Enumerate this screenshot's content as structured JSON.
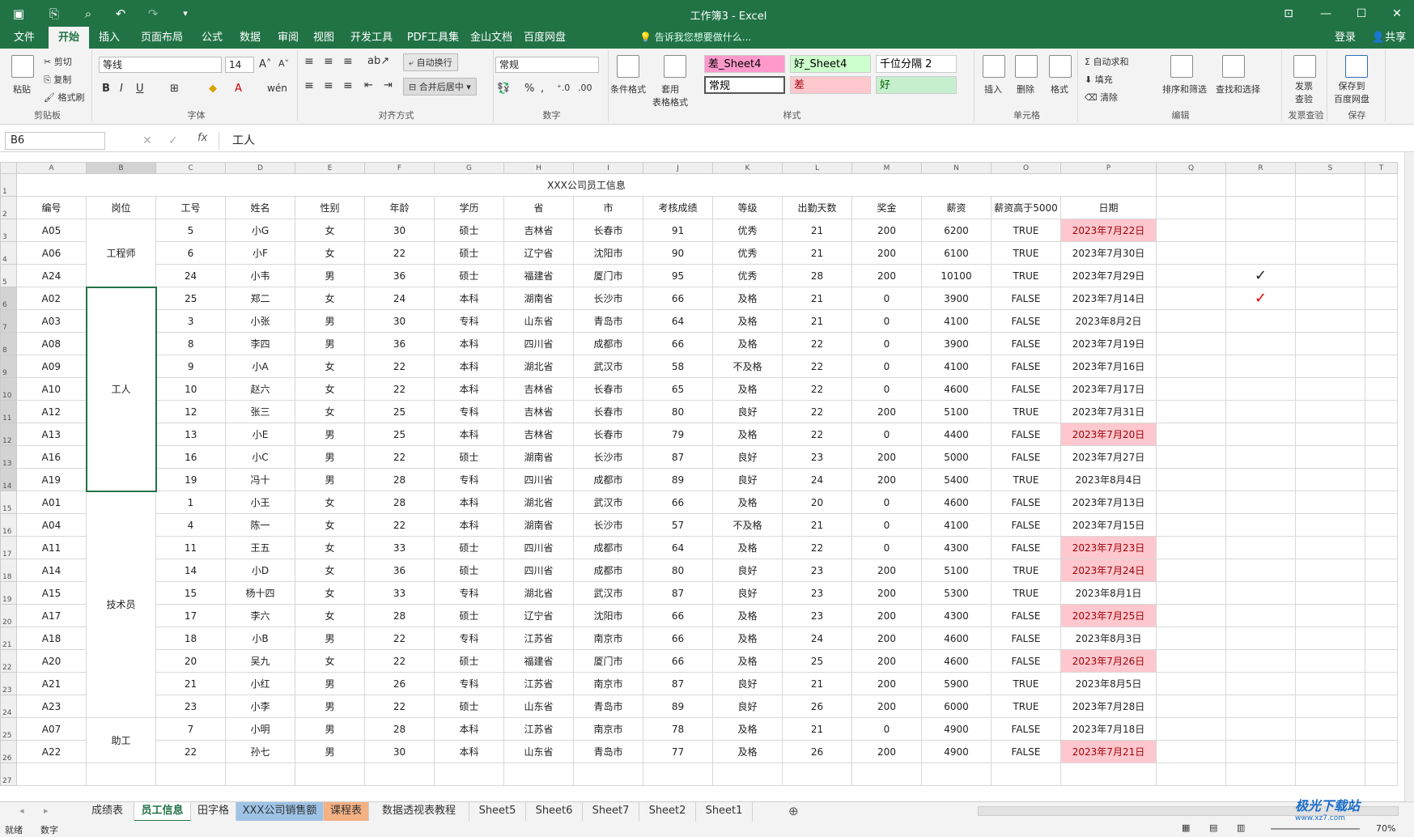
{
  "title": "工作簿3 - Excel",
  "menu": [
    "文件",
    "开始",
    "插入",
    "页面布局",
    "公式",
    "数据",
    "审阅",
    "视图",
    "开发工具",
    "PDF工具集",
    "金山文档",
    "百度网盘"
  ],
  "tell": "告诉我您想要做什么...",
  "account": {
    "login": "登录",
    "share": "共享"
  },
  "ribbon": {
    "clipboard": {
      "label": "剪贴板",
      "paste": "粘贴",
      "cut": "剪切",
      "copy": "复制",
      "painter": "格式刷"
    },
    "font": {
      "label": "字体",
      "name": "等线",
      "size": "14"
    },
    "align": {
      "label": "对齐方式",
      "wrap": "自动换行",
      "merge": "合并后居中"
    },
    "number": {
      "label": "数字",
      "format": "常规"
    },
    "styles": {
      "label": "样式",
      "cond": "条件格式",
      "table": "套用\n表格格式",
      "boxes": [
        "差_Sheet4",
        "好_Sheet4",
        "千位分隔 2",
        "常规",
        "差",
        "好"
      ]
    },
    "cells": {
      "label": "单元格",
      "insert": "插入",
      "delete": "删除",
      "format": "格式"
    },
    "edit": {
      "label": "编辑",
      "autosum": "自动求和",
      "fill": "填充",
      "clear": "清除",
      "sort": "排序和筛选",
      "find": "查找和选择"
    },
    "invoice": {
      "label": "发票查验",
      "btn": "发票\n查验"
    },
    "save": {
      "label": "保存",
      "btn": "保存到\n百度网盘"
    }
  },
  "namebox": "B6",
  "formula": "工人",
  "columns": [
    "A",
    "B",
    "C",
    "D",
    "E",
    "F",
    "G",
    "H",
    "I",
    "J",
    "K",
    "L",
    "M",
    "N",
    "O",
    "P",
    "Q",
    "R",
    "S",
    "T"
  ],
  "sheet_title": "XXX公司员工信息",
  "headers": [
    "编号",
    "岗位",
    "工号",
    "姓名",
    "性别",
    "年龄",
    "学历",
    "省",
    "市",
    "考核成绩",
    "等级",
    "出勤天数",
    "奖金",
    "薪资",
    "薪资高于5000",
    "日期"
  ],
  "groups": [
    {
      "label": "工程师",
      "start": 3,
      "span": 3
    },
    {
      "label": "工人",
      "start": 6,
      "span": 9
    },
    {
      "label": "技术员",
      "start": 15,
      "span": 10
    },
    {
      "label": "助工",
      "start": 25,
      "span": 2
    }
  ],
  "rows": [
    [
      "A05",
      "5",
      "小G",
      "女",
      "30",
      "硕士",
      "吉林省",
      "长春市",
      "91",
      "优秀",
      "21",
      "200",
      "6200",
      "TRUE",
      "2023年7月22日"
    ],
    [
      "A06",
      "6",
      "小F",
      "女",
      "22",
      "硕士",
      "辽宁省",
      "沈阳市",
      "90",
      "优秀",
      "21",
      "200",
      "6100",
      "TRUE",
      "2023年7月30日"
    ],
    [
      "A24",
      "24",
      "小韦",
      "男",
      "36",
      "硕士",
      "福建省",
      "厦门市",
      "95",
      "优秀",
      "28",
      "200",
      "10100",
      "TRUE",
      "2023年7月29日"
    ],
    [
      "A02",
      "25",
      "郑二",
      "女",
      "24",
      "本科",
      "湖南省",
      "长沙市",
      "66",
      "及格",
      "21",
      "0",
      "3900",
      "FALSE",
      "2023年7月14日"
    ],
    [
      "A03",
      "3",
      "小张",
      "男",
      "30",
      "专科",
      "山东省",
      "青岛市",
      "64",
      "及格",
      "21",
      "0",
      "4100",
      "FALSE",
      "2023年8月2日"
    ],
    [
      "A08",
      "8",
      "李四",
      "男",
      "36",
      "本科",
      "四川省",
      "成都市",
      "66",
      "及格",
      "22",
      "0",
      "3900",
      "FALSE",
      "2023年7月19日"
    ],
    [
      "A09",
      "9",
      "小A",
      "女",
      "22",
      "本科",
      "湖北省",
      "武汉市",
      "58",
      "不及格",
      "22",
      "0",
      "4100",
      "FALSE",
      "2023年7月16日"
    ],
    [
      "A10",
      "10",
      "赵六",
      "女",
      "22",
      "本科",
      "吉林省",
      "长春市",
      "65",
      "及格",
      "22",
      "0",
      "4600",
      "FALSE",
      "2023年7月17日"
    ],
    [
      "A12",
      "12",
      "张三",
      "女",
      "25",
      "专科",
      "吉林省",
      "长春市",
      "80",
      "良好",
      "22",
      "200",
      "5100",
      "TRUE",
      "2023年7月31日"
    ],
    [
      "A13",
      "13",
      "小E",
      "男",
      "25",
      "本科",
      "吉林省",
      "长春市",
      "79",
      "及格",
      "22",
      "0",
      "4400",
      "FALSE",
      "2023年7月20日"
    ],
    [
      "A16",
      "16",
      "小C",
      "男",
      "22",
      "硕士",
      "湖南省",
      "长沙市",
      "87",
      "良好",
      "23",
      "200",
      "5000",
      "FALSE",
      "2023年7月27日"
    ],
    [
      "A19",
      "19",
      "冯十",
      "男",
      "28",
      "专科",
      "四川省",
      "成都市",
      "89",
      "良好",
      "24",
      "200",
      "5400",
      "TRUE",
      "2023年8月4日"
    ],
    [
      "A01",
      "1",
      "小王",
      "女",
      "28",
      "本科",
      "湖北省",
      "武汉市",
      "66",
      "及格",
      "20",
      "0",
      "4600",
      "FALSE",
      "2023年7月13日"
    ],
    [
      "A04",
      "4",
      "陈一",
      "女",
      "22",
      "本科",
      "湖南省",
      "长沙市",
      "57",
      "不及格",
      "21",
      "0",
      "4100",
      "FALSE",
      "2023年7月15日"
    ],
    [
      "A11",
      "11",
      "王五",
      "女",
      "33",
      "硕士",
      "四川省",
      "成都市",
      "64",
      "及格",
      "22",
      "0",
      "4300",
      "FALSE",
      "2023年7月23日"
    ],
    [
      "A14",
      "14",
      "小D",
      "女",
      "36",
      "硕士",
      "四川省",
      "成都市",
      "80",
      "良好",
      "23",
      "200",
      "5100",
      "TRUE",
      "2023年7月24日"
    ],
    [
      "A15",
      "15",
      "杨十四",
      "女",
      "33",
      "专科",
      "湖北省",
      "武汉市",
      "87",
      "良好",
      "23",
      "200",
      "5300",
      "TRUE",
      "2023年8月1日"
    ],
    [
      "A17",
      "17",
      "李六",
      "女",
      "28",
      "硕士",
      "辽宁省",
      "沈阳市",
      "66",
      "及格",
      "23",
      "200",
      "4300",
      "FALSE",
      "2023年7月25日"
    ],
    [
      "A18",
      "18",
      "小B",
      "男",
      "22",
      "专科",
      "江苏省",
      "南京市",
      "66",
      "及格",
      "24",
      "200",
      "4600",
      "FALSE",
      "2023年8月3日"
    ],
    [
      "A20",
      "20",
      "吴九",
      "女",
      "22",
      "硕士",
      "福建省",
      "厦门市",
      "66",
      "及格",
      "25",
      "200",
      "4600",
      "FALSE",
      "2023年7月26日"
    ],
    [
      "A21",
      "21",
      "小红",
      "男",
      "26",
      "专科",
      "江苏省",
      "南京市",
      "87",
      "良好",
      "21",
      "200",
      "5900",
      "TRUE",
      "2023年8月5日"
    ],
    [
      "A23",
      "23",
      "小李",
      "男",
      "22",
      "硕士",
      "山东省",
      "青岛市",
      "89",
      "良好",
      "26",
      "200",
      "6000",
      "TRUE",
      "2023年7月28日"
    ],
    [
      "A07",
      "7",
      "小明",
      "男",
      "28",
      "本科",
      "江苏省",
      "南京市",
      "78",
      "及格",
      "21",
      "0",
      "4900",
      "FALSE",
      "2023年7月18日"
    ],
    [
      "A22",
      "22",
      "孙七",
      "男",
      "30",
      "本科",
      "山东省",
      "青岛市",
      "77",
      "及格",
      "26",
      "200",
      "4900",
      "FALSE",
      "2023年7月21日"
    ]
  ],
  "pink_rows": [
    0,
    9,
    14,
    15,
    17,
    19,
    23
  ],
  "marks": {
    "row5": "✓",
    "row6": "✓"
  },
  "sheets": [
    "成绩表",
    "员工信息",
    "田字格",
    "XXX公司销售额",
    "课程表",
    "数据透视表教程",
    "Sheet5",
    "Sheet6",
    "Sheet7",
    "Sheet2",
    "Sheet1"
  ],
  "active_sheet": "员工信息",
  "status": {
    "ready": "就绪",
    "mode": "数字",
    "zoom": "70%"
  },
  "watermark": "极光下载站",
  "watermark_url": "www.xz7.com"
}
